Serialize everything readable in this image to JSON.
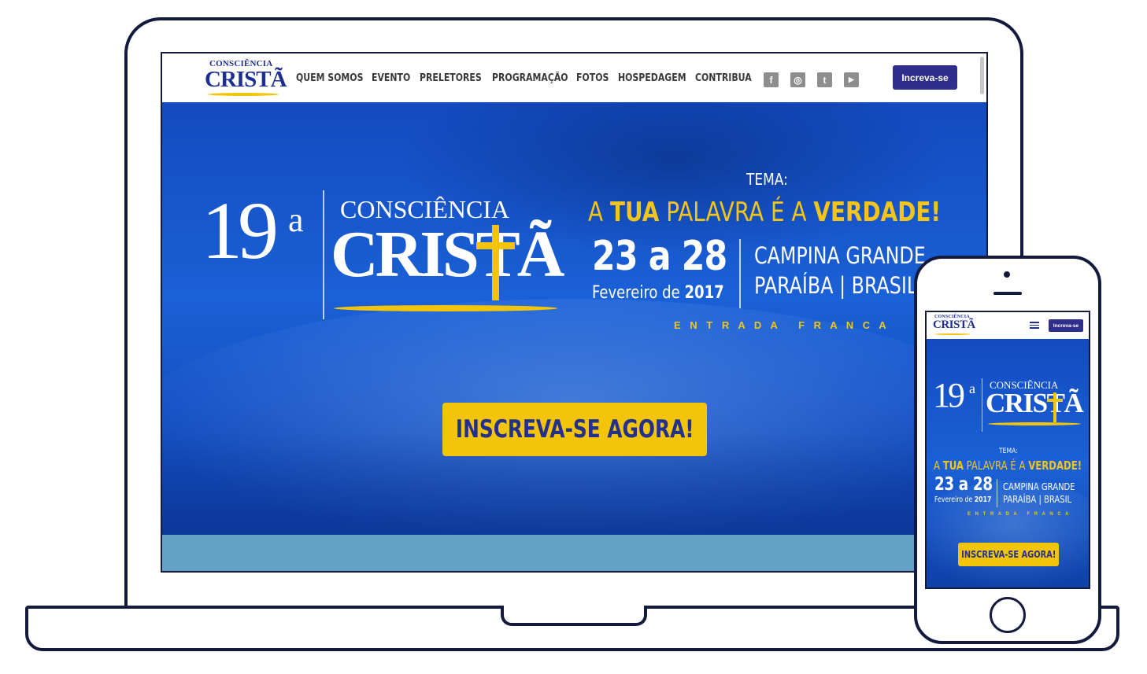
{
  "brand": {
    "logo_top": "CONSCIÊNCIA",
    "logo_main": "CRISTÃ"
  },
  "nav": {
    "items": [
      {
        "label": "QUEM SOMOS",
        "name": "nav-quem-somos"
      },
      {
        "label": "EVENTO",
        "name": "nav-evento"
      },
      {
        "label": "PRELETORES",
        "name": "nav-preletores"
      },
      {
        "label": "PROGRAMAÇÃO",
        "name": "nav-programacao"
      },
      {
        "label": "FOTOS",
        "name": "nav-fotos"
      },
      {
        "label": "HOSPEDAGEM",
        "name": "nav-hospedagem"
      },
      {
        "label": "CONTRIBUA",
        "name": "nav-contribua"
      }
    ],
    "social": [
      {
        "icon": "facebook-icon",
        "glyph": "f"
      },
      {
        "icon": "instagram-icon",
        "glyph": "◎"
      },
      {
        "icon": "twitter-icon",
        "glyph": "t"
      },
      {
        "icon": "youtube-icon",
        "glyph": "▶"
      }
    ],
    "cta_label": "Increva-se"
  },
  "hero": {
    "edition_number": "19",
    "edition_suffix": "a",
    "logo_top": "CONSCIÊNCIA",
    "logo_main": "CRISTÃ",
    "theme_label": "TEMA:",
    "theme_part1": "A ",
    "theme_part2": "TUA",
    "theme_part3": " PALAVRA É A ",
    "theme_part4": "VERDADE!",
    "dates": "23 a 28",
    "month_prefix": "Fevereiro de ",
    "year": "2017",
    "city": "CAMPINA GRANDE",
    "state_country": "PARAÍBA | BRASIL",
    "entry": "E N T R A D A   F R A N C A",
    "cta_label": "INSCREVA-SE AGORA!"
  },
  "mobile": {
    "menu_icon": "hamburger-menu-icon",
    "cta_label": "Increva-se"
  },
  "colors": {
    "brand_blue": "#1d2f93",
    "hero_blue": "#1a60d6",
    "accent_yellow": "#f2c40a",
    "nav_cta": "#2f2e8d",
    "device_outline": "#131a3c"
  }
}
